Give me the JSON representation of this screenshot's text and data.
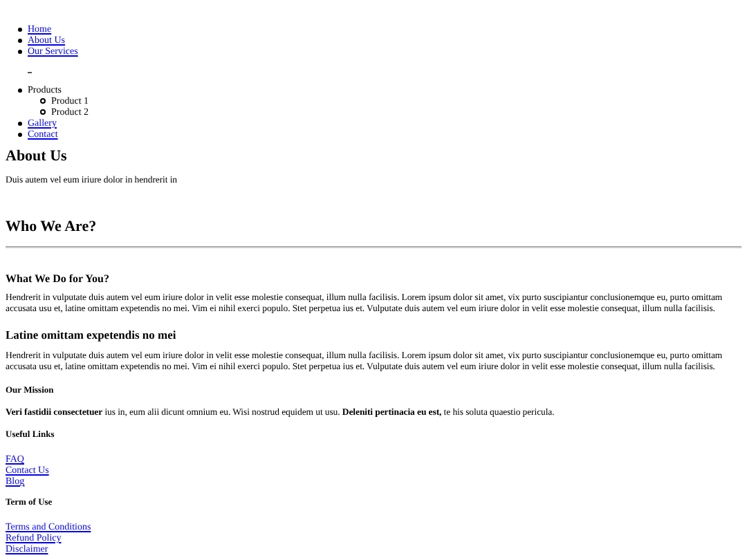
{
  "nav": {
    "items": [
      {
        "label": "Home",
        "kind": "link"
      },
      {
        "label": "About Us",
        "kind": "link"
      },
      {
        "label": "Our Services",
        "kind": "link"
      },
      {
        "kind": "mark"
      },
      {
        "label": "Products",
        "kind": "menu",
        "children": [
          {
            "label": "Product 1"
          },
          {
            "label": "Product 2"
          }
        ]
      },
      {
        "label": "Gallery",
        "kind": "link"
      },
      {
        "label": "Contact",
        "kind": "link"
      }
    ]
  },
  "about": {
    "heading": "About Us",
    "text": "Duis autem vel eum iriure dolor in hendrerit in"
  },
  "who_we_are": {
    "heading": "Who We Are?"
  },
  "articles": [
    {
      "heading": "What We Do for You?",
      "kind": "small",
      "text": "Hendrerit in vulputate duis autem vel eum iriure dolor in velit esse molestie consequat, illum nulla facilisis. Lorem ipsum dolor sit amet, vix purto suscipiantur conclusionemque eu, purto omittam accusata usu et, latine omittam expetendis no mei. Vim ei nihil exerci populo. Stet perpetua ius et. Vulputate duis autem vel eum iriure dolor in velit esse molestie consequat, illum nulla facilisis."
    },
    {
      "heading": "Latine omittam expetendis no mei",
      "kind": "large",
      "text": "Hendrerit in vulputate duis autem vel eum iriure dolor in velit esse molestie consequat, illum nulla facilisis. Lorem ipsum dolor sit amet, vix purto suscipiantur conclusionemque eu, purto omittam accusata usu et, latine omittam expetendis no mei. Vim ei nihil exerci populo. Stet perpetua ius et. Vulputate duis autem vel eum iriure dolor in velit esse molestie consequat, illum nulla facilisis."
    }
  ],
  "mission": {
    "heading": "Our Mission",
    "text": "**Veri fastidii consectetuer** ius in, eum alii dicunt omnium eu. Wisi nostrud equidem ut usu. **Deleniti pertinacia eu est,** te his soluta quaestio pericula."
  },
  "footer": [
    {
      "heading": "Useful Links",
      "links": [
        "FAQ",
        "Contact Us",
        "Blog"
      ]
    },
    {
      "heading": "Term of Use",
      "links": [
        "Terms and Conditions",
        "Refund Policy",
        "Disclaimer"
      ]
    }
  ]
}
